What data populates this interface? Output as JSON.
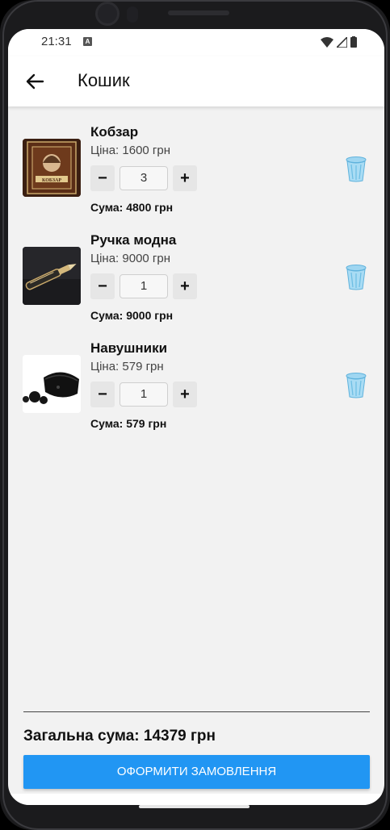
{
  "status_bar": {
    "time": "21:31",
    "notif_icon": "notification-icon"
  },
  "app_bar": {
    "title": "Кошик",
    "back_icon": "arrow-back-icon"
  },
  "cart": {
    "items": [
      {
        "name": "Кобзар",
        "price": "Ціна: 1600 грн",
        "qty": "3",
        "sum": "Сума: 4800 грн",
        "minus": "−",
        "plus": "+"
      },
      {
        "name": "Ручка модна",
        "price": "Ціна: 9000 грн",
        "qty": "1",
        "sum": "Сума: 9000 грн",
        "minus": "−",
        "plus": "+"
      },
      {
        "name": "Навушники",
        "price": "Ціна: 579 грн",
        "qty": "1",
        "sum": "Сума: 579 грн",
        "minus": "−",
        "plus": "+"
      }
    ]
  },
  "footer": {
    "total": "Загальна сума: 14379 грн",
    "checkout_label": "ОФОРМИТИ ЗАМОВЛЕННЯ"
  },
  "colors": {
    "accent": "#2196f3",
    "background": "#f2f2f2",
    "trash": "#7fc6ea"
  }
}
